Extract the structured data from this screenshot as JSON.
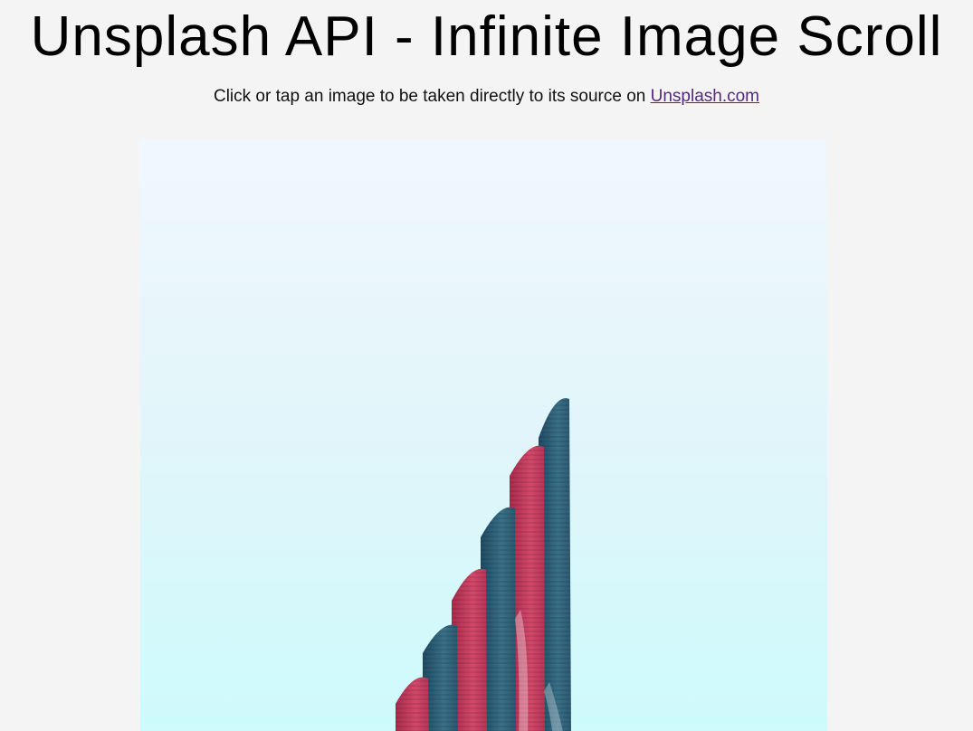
{
  "header": {
    "title": "Unsplash API - Infinite Image Scroll",
    "subtitle_prefix": "Click or tap an image to be taken directly to its source on ",
    "subtitle_link": "Unsplash.com"
  },
  "gallery": {
    "images": [
      {
        "subject": "pink and teal skyscraper against pale blue sky"
      }
    ]
  },
  "colors": {
    "background": "#f4f4f4",
    "link": "#55287f",
    "sky_top": "#f1f8fd",
    "sky_bottom": "#cdfbfc",
    "building_teal": "#2f5f78",
    "building_pink": "#c23a5c"
  }
}
